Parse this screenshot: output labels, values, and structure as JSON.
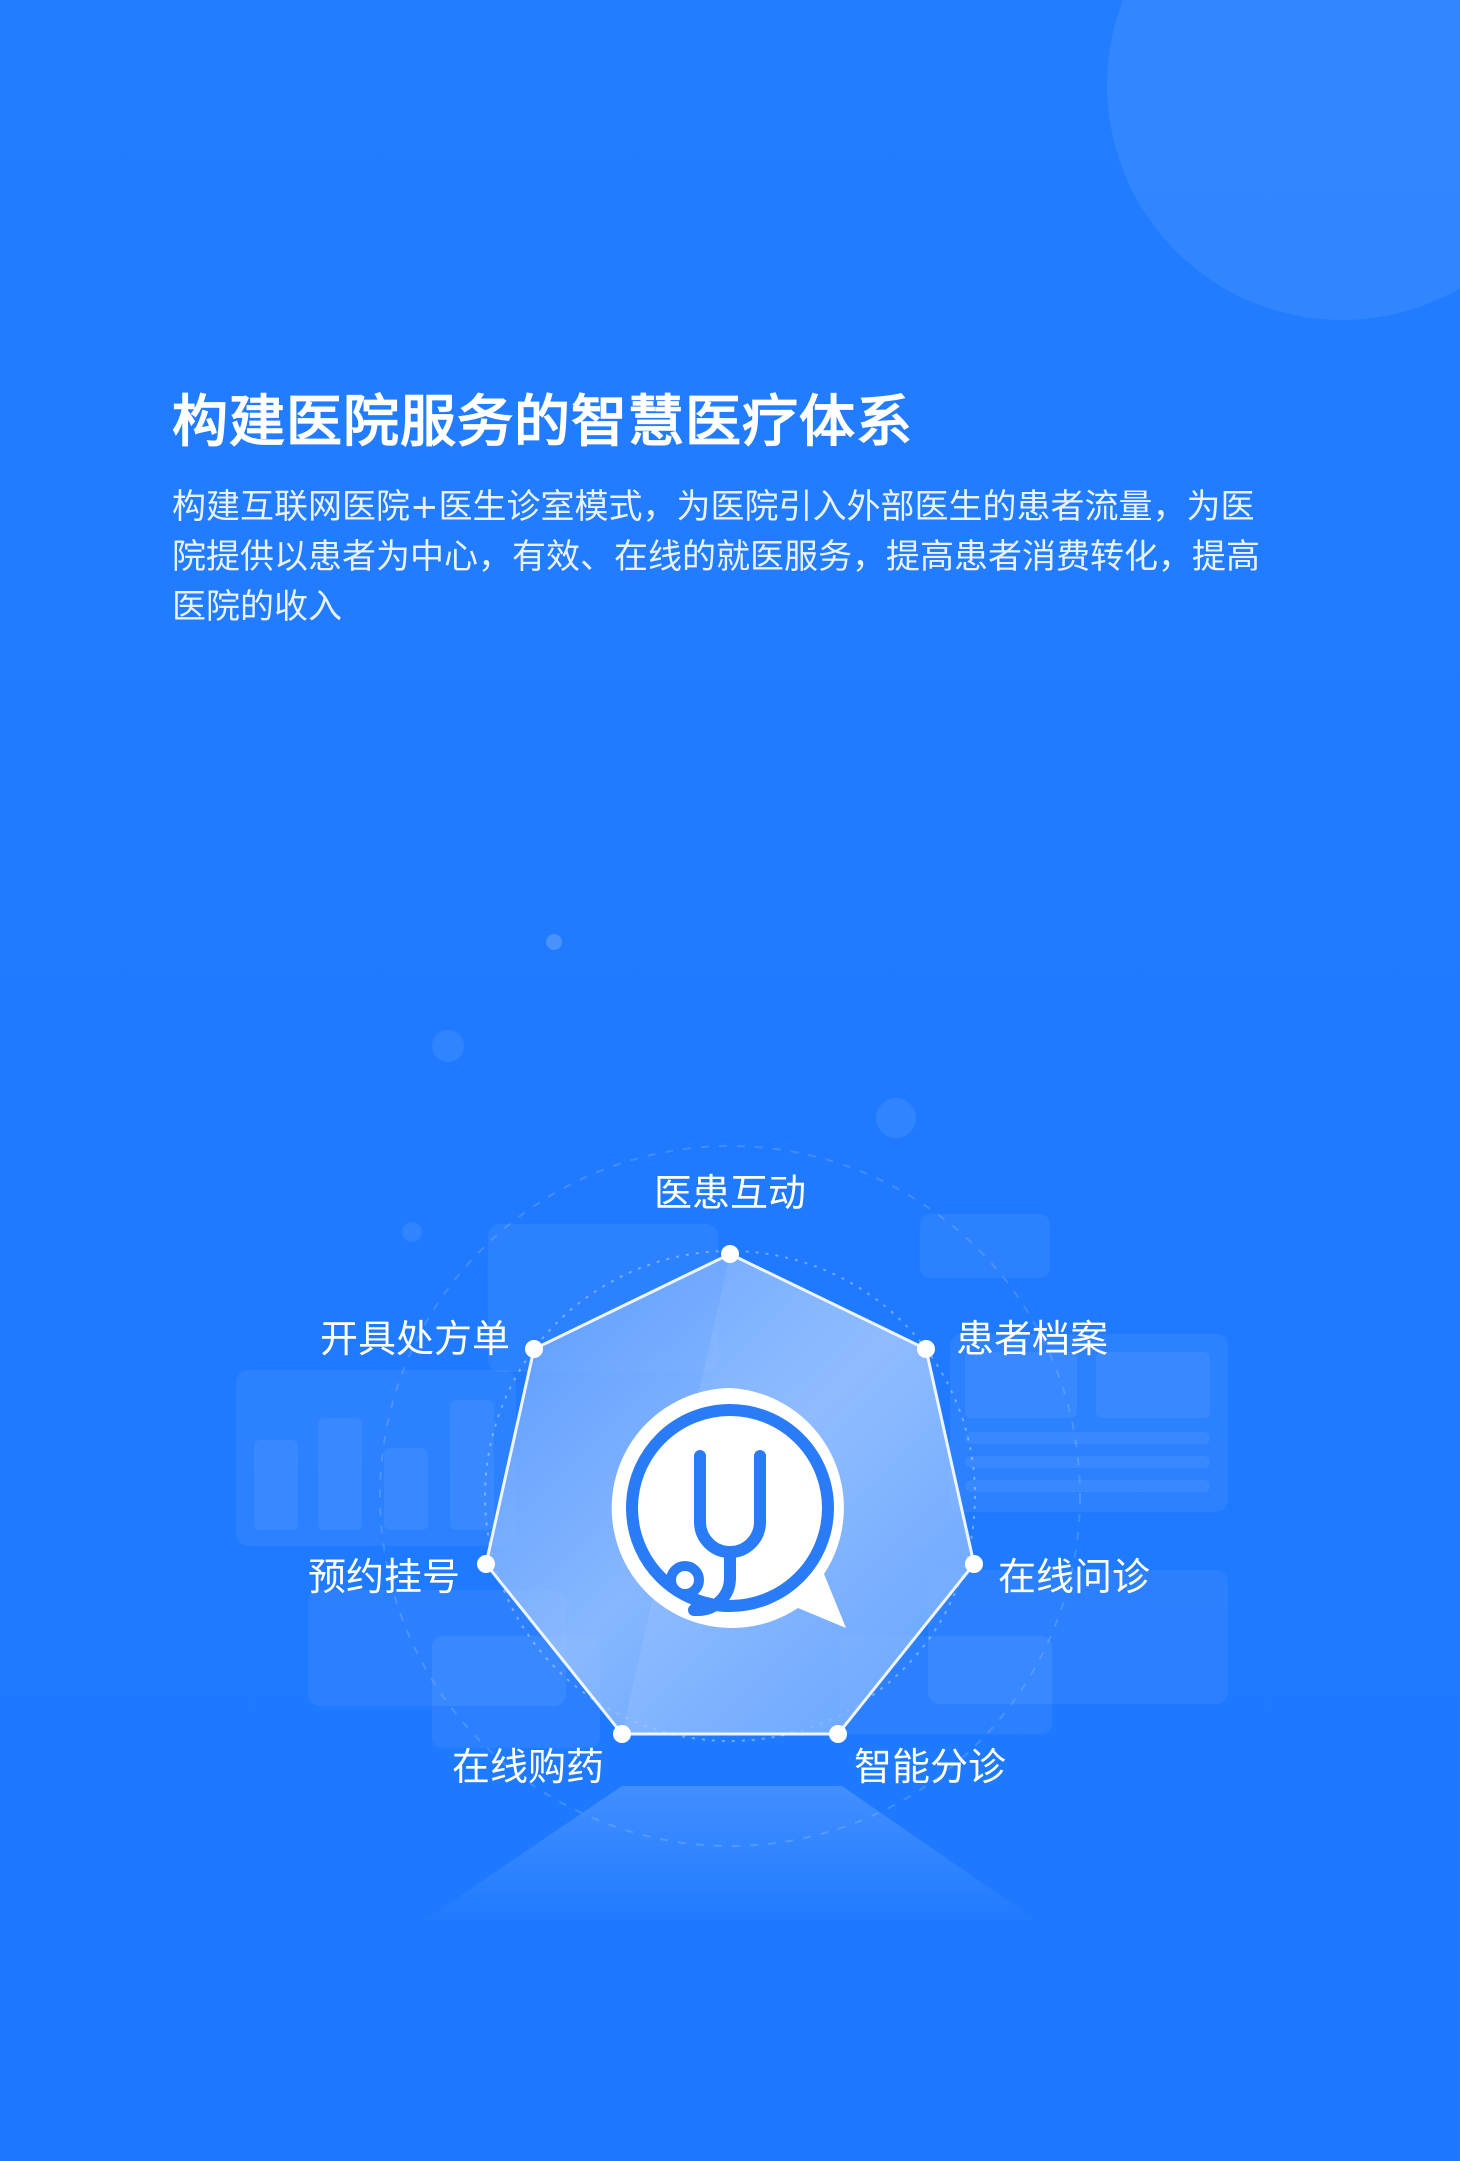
{
  "header": {
    "title": "构建医院服务的智慧医疗体系",
    "description": "构建互联网医院+医生诊室模式，为医院引入外部医生的患者流量，为医院提供以患者为中心，有效、在线的就医服务，提高患者消费转化，提高医院的收入"
  },
  "diagram": {
    "center_icon": "stethoscope-chat-icon",
    "nodes": [
      {
        "label": "医患互动"
      },
      {
        "label": "患者档案"
      },
      {
        "label": "在线问诊"
      },
      {
        "label": "智能分诊"
      },
      {
        "label": "在线购药"
      },
      {
        "label": "预约挂号"
      },
      {
        "label": "开具处方单"
      }
    ]
  },
  "colors": {
    "background": "#1f7aff",
    "text": "#ffffff",
    "icon": "#2a7cf6"
  }
}
